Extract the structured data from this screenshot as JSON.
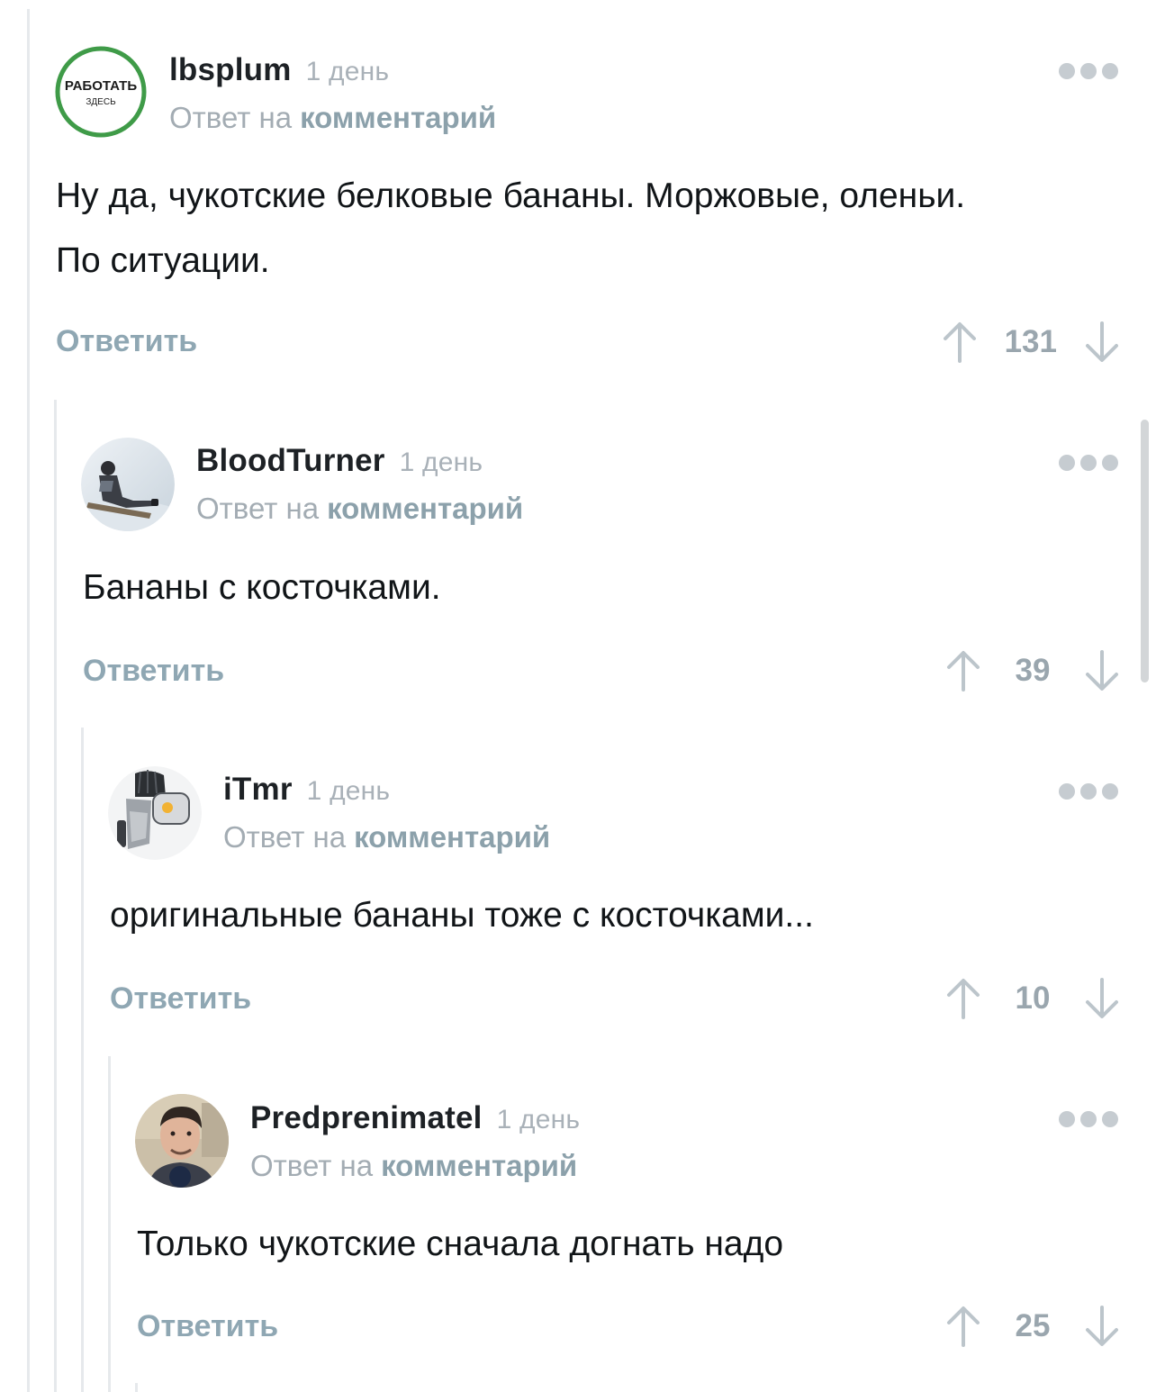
{
  "comments": [
    {
      "username": "lbsplum",
      "time": "1 день",
      "reply_prefix": "Ответ на",
      "reply_link": "комментарий",
      "text_lines": [
        "Ну да, чукотские белковые бананы. Моржовые, оленьи.",
        "По ситуации."
      ],
      "reply_label": "Ответить",
      "score": "131",
      "avatar_text": [
        "РАБОТАТЬ",
        "ЗДЕСЬ"
      ]
    },
    {
      "username": "BloodTurner",
      "time": "1 день",
      "reply_prefix": "Ответ на",
      "reply_link": "комментарий",
      "text_lines": [
        "Бананы с косточками."
      ],
      "reply_label": "Ответить",
      "score": "39"
    },
    {
      "username": "iTmr",
      "time": "1 день",
      "reply_prefix": "Ответ на",
      "reply_link": "комментарий",
      "text_lines": [
        "оригинальные бананы тоже с косточками..."
      ],
      "reply_label": "Ответить",
      "score": "10"
    },
    {
      "username": "Predprenimatel",
      "time": "1 день",
      "reply_prefix": "Ответ на",
      "reply_link": "комментарий",
      "text_lines": [
        "Только чукотские сначала догнать надо"
      ],
      "reply_label": "Ответить",
      "score": "25"
    }
  ],
  "icons": {
    "more": "more-dots-icon",
    "upvote": "arrow-up-icon",
    "downvote": "arrow-down-icon"
  },
  "colors": {
    "username": "#1d2125",
    "muted": "#a3acb3",
    "accent_link": "#8ca1ab",
    "reply_button": "#8fa7b3",
    "avatar_ring": "#3f9b48"
  }
}
